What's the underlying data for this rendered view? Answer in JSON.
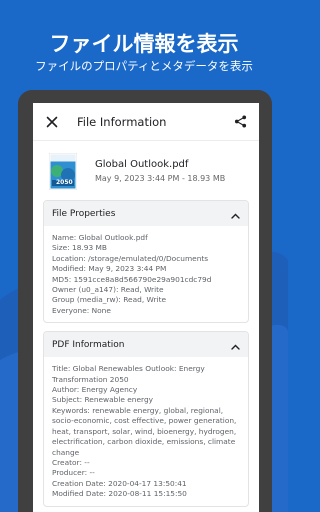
{
  "promo": {
    "title": "ファイル情報を表示",
    "subtitle": "ファイルのプロパティとメタデータを表示"
  },
  "colors": {
    "background": "#1a68c8",
    "phone_frame": "#404040",
    "accent": "#1a73e8"
  },
  "appbar": {
    "close_icon": "close-icon",
    "title": "File Information",
    "share_icon": "share-icon"
  },
  "file": {
    "name": "Global Outlook.pdf",
    "subtitle": "May 9, 2023 3:44 PM - 18.93 MB",
    "thumbnail_text": "2050"
  },
  "file_properties": {
    "title": "File Properties",
    "rows": [
      "Name: Global Outlook.pdf",
      "Size: 18.93 MB",
      "Location: /storage/emulated/0/Documents",
      "Modified: May 9, 2023 3:44 PM",
      "MD5: 1591cce8a8d566790e29a901cdc79d",
      "Owner (u0_a147): Read, Write",
      "Group (media_rw): Read, Write",
      "Everyone: None"
    ]
  },
  "pdf_information": {
    "title": "PDF Information",
    "rows": [
      "Title: Global Renewables Outlook: Energy Transformation 2050",
      "Author: Energy Agency",
      "Subject: Renewable energy",
      "Keywords: renewable energy, global, regional, socio-economic, cost effective, power generation, heat, transport, solar, wind, bioenergy, hydrogen, electrification, carbon dioxide, emissions, climate change",
      "Creator: --",
      "Producer: --",
      "Creation Date: 2020-04-17 13:50:41",
      "Modified Date: 2020-08-11 15:15:50"
    ]
  }
}
